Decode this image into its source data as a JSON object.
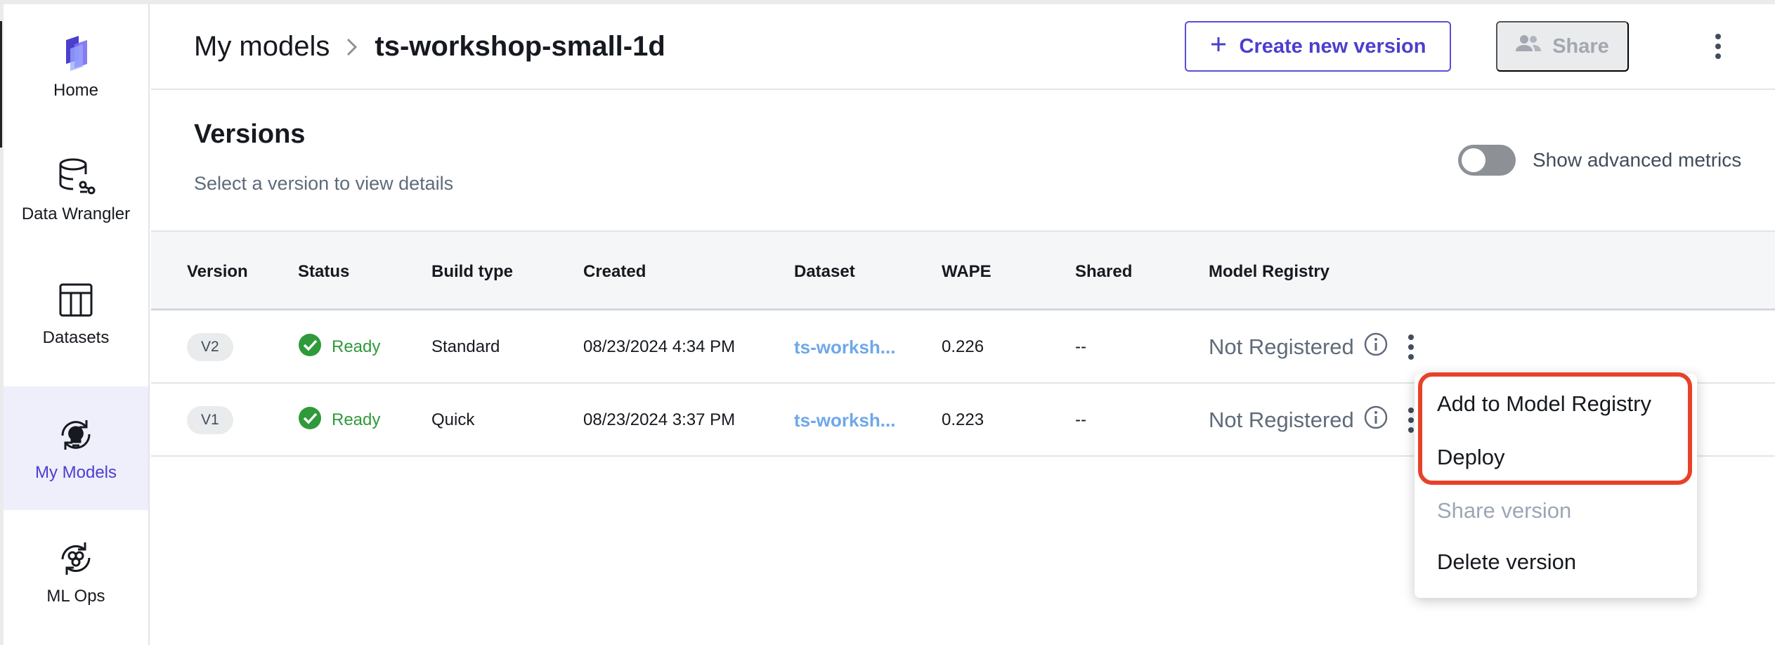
{
  "sidebar": {
    "items": [
      {
        "label": "Home",
        "icon": "canvas-logo-icon",
        "active": false
      },
      {
        "label": "Data Wrangler",
        "icon": "database-icon",
        "active": false
      },
      {
        "label": "Datasets",
        "icon": "table-icon",
        "active": false
      },
      {
        "label": "My Models",
        "icon": "model-bulb-icon",
        "active": true
      },
      {
        "label": "ML Ops",
        "icon": "mlops-cycle-icon",
        "active": false
      }
    ]
  },
  "header": {
    "breadcrumb_root": "My models",
    "breadcrumb_current": "ts-workshop-small-1d",
    "create_label": "Create new version",
    "share_label": "Share"
  },
  "versions": {
    "title": "Versions",
    "subtitle": "Select a version to view details",
    "toggle_label": "Show advanced metrics"
  },
  "table": {
    "columns": [
      "Version",
      "Status",
      "Build type",
      "Created",
      "Dataset",
      "WAPE",
      "Shared",
      "Model Registry"
    ],
    "rows": [
      {
        "version": "V2",
        "status": "Ready",
        "build_type": "Standard",
        "created": "08/23/2024 4:34 PM",
        "dataset": "ts-worksh...",
        "wape": "0.226",
        "shared": "--",
        "registry": "Not Registered"
      },
      {
        "version": "V1",
        "status": "Ready",
        "build_type": "Quick",
        "created": "08/23/2024 3:37 PM",
        "dataset": "ts-worksh...",
        "wape": "0.223",
        "shared": "--",
        "registry": "Not Registered"
      }
    ]
  },
  "menu": {
    "items": [
      {
        "label": "Add to Model Registry",
        "disabled": false
      },
      {
        "label": "Deploy",
        "disabled": false
      },
      {
        "label": "Share version",
        "disabled": true
      },
      {
        "label": "Delete version",
        "disabled": false
      }
    ]
  },
  "colors": {
    "accent": "#4b3fce",
    "ready_green": "#2e9a3a",
    "link_blue": "#6ea8e8",
    "highlight_red": "#e8412a"
  }
}
